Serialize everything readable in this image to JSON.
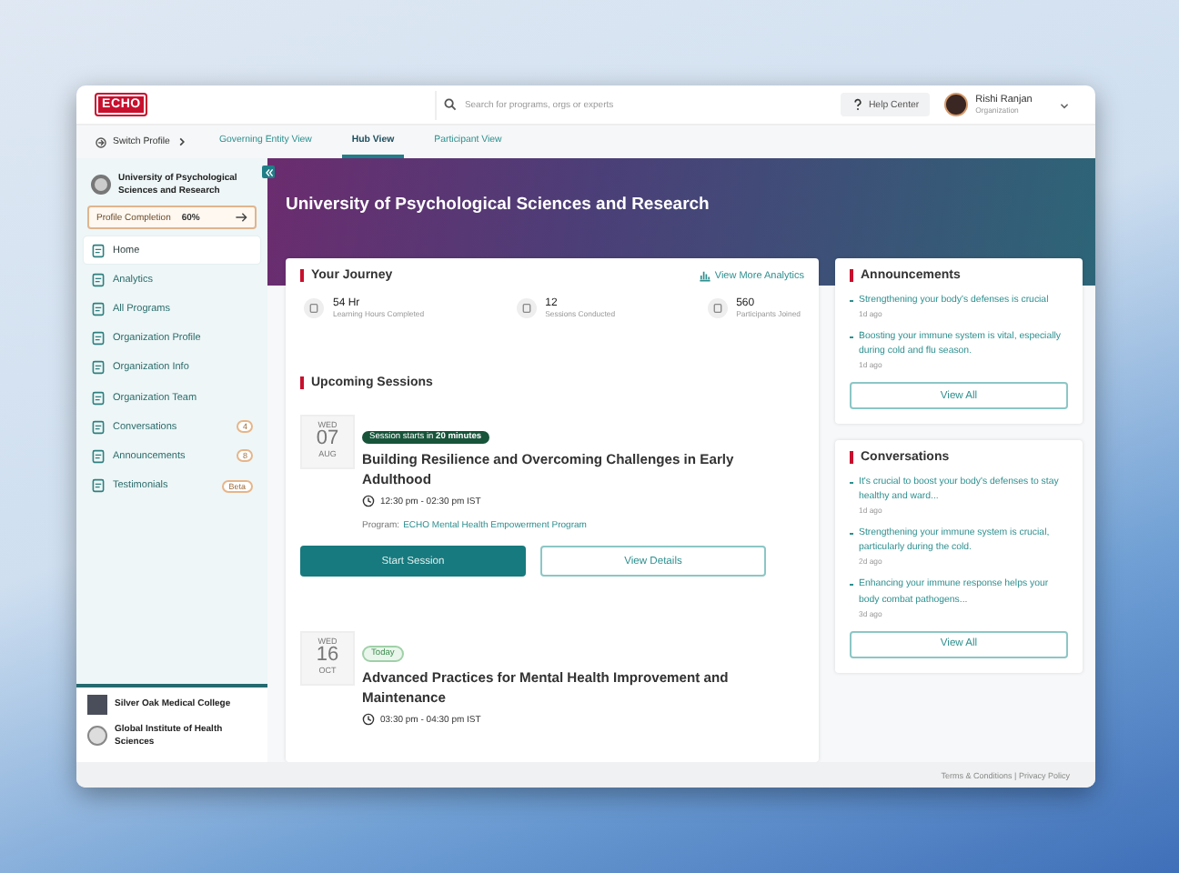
{
  "header": {
    "logo": "ECHO",
    "search": {
      "placeholder": "Search for programs, orgs or experts"
    },
    "help": "Help Center",
    "user": {
      "name": "Rishi Ranjan",
      "role": "Organization"
    }
  },
  "nav": {
    "switch_profile": "Switch Profile",
    "tabs": [
      {
        "label": "Governing Entity View",
        "selected": false
      },
      {
        "label": "Hub View",
        "selected": true
      },
      {
        "label": "Participant View",
        "selected": false
      }
    ]
  },
  "sidebar": {
    "org": "University of Psychological Sciences and Research",
    "completion": {
      "label": "Profile Completion",
      "value": "60%"
    },
    "items": [
      {
        "label": "Home",
        "selected": true
      },
      {
        "label": "Analytics",
        "selected": false
      },
      {
        "label": "All Programs",
        "selected": false
      },
      {
        "label": "Organization Profile",
        "selected": false
      },
      {
        "label": "Organization Info",
        "selected": false
      },
      {
        "label": "Organization Team",
        "selected": false
      },
      {
        "label": "Conversations",
        "selected": false,
        "badge": "4"
      },
      {
        "label": "Announcements",
        "selected": false,
        "badge": "8"
      },
      {
        "label": "Testimonials",
        "selected": false,
        "badge": "Beta"
      }
    ],
    "other_orgs": [
      {
        "name": "Silver Oak Medical College",
        "kind": "square"
      },
      {
        "name": "Global Institute of Health Sciences",
        "kind": "round"
      }
    ]
  },
  "banner": {
    "title": "University of Psychological Sciences and Research"
  },
  "journey": {
    "title": "Your Journey",
    "link": "View More Analytics",
    "stats": [
      {
        "value": "54 Hr",
        "label": "Learning Hours Completed"
      },
      {
        "value": "12",
        "label": "Sessions Conducted"
      },
      {
        "value": "560",
        "label": "Participants Joined"
      }
    ]
  },
  "sessions": {
    "title": "Upcoming Sessions",
    "items": [
      {
        "weekday": "WED",
        "day": "07",
        "month": "AUG",
        "tag": "Session starts in **20 minutes**",
        "kind": "countdown",
        "title": "Building Resilience and Overcoming Challenges in Early Adulthood",
        "time": "12:30 pm - 02:30 pm IST",
        "program_label": "Program:",
        "program": "ECHO Mental Health Empowerment Program",
        "buttons": [
          "Start Session",
          "View Details"
        ]
      },
      {
        "weekday": "WED",
        "day": "16",
        "month": "OCT",
        "tag": "Today",
        "kind": "today",
        "title": "Advanced Practices for Mental Health Improvement and Maintenance",
        "time": "03:30 pm - 04:30 pm IST"
      }
    ]
  },
  "announcements": {
    "title": "Announcements",
    "items": [
      {
        "text": "Strengthening your body's defenses is crucial",
        "time": "1d ago"
      },
      {
        "text": "Boosting your immune system is vital, especially during cold and flu season.",
        "time": "1d ago"
      }
    ],
    "button": "View All"
  },
  "conversations": {
    "title": "Conversations",
    "items": [
      {
        "text": "It's crucial to boost your body's defenses to stay healthy and ward...",
        "time": "1d ago"
      },
      {
        "text": "Strengthening your immune system is crucial, particularly during the cold.",
        "time": "2d ago"
      },
      {
        "text": "Enhancing your immune response helps your body combat pathogens...",
        "time": "3d ago"
      }
    ],
    "button": "View All"
  },
  "footer": {
    "links": "Terms & Conditions | Privacy Policy"
  }
}
